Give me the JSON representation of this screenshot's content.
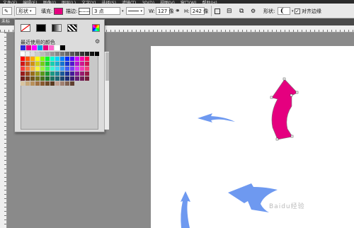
{
  "menubar": {
    "items": [
      "文件(F)",
      "编辑(E)",
      "图像(I)",
      "图层(L)",
      "文字(Y)",
      "选择(S)",
      "滤镜(T)",
      "3D(D)",
      "视图(V)",
      "窗口(W)",
      "帮助(H)"
    ]
  },
  "options": {
    "mode": "形状",
    "fill_label": "填充:",
    "fill_color": "#e5007f",
    "stroke_label": "描边:",
    "stroke_width": "3 点",
    "w_label": "W:",
    "w_value": "127 像",
    "link_icon": "link-icon",
    "h_label": "H:",
    "h_value": "242 像",
    "shape_label": "形状:",
    "align_edges": "对齐边缘"
  },
  "tab": {
    "title": "未标"
  },
  "popup": {
    "recent_title": "最近使用的颜色",
    "fill_types": [
      "no-fill",
      "solid-color",
      "gradient",
      "pattern"
    ],
    "recent_colors": [
      "#2b2bd8",
      "#e5007f",
      "#ff00ff",
      "#00a0e9",
      "#e5007f",
      "#ff66cc",
      "#ffffff",
      "#000000"
    ]
  },
  "canvas": {
    "background": "#ffffff",
    "shape_color_blue": "#6e99f0",
    "shape_color_pink": "#e5007f"
  },
  "watermark": "Baidu经验"
}
